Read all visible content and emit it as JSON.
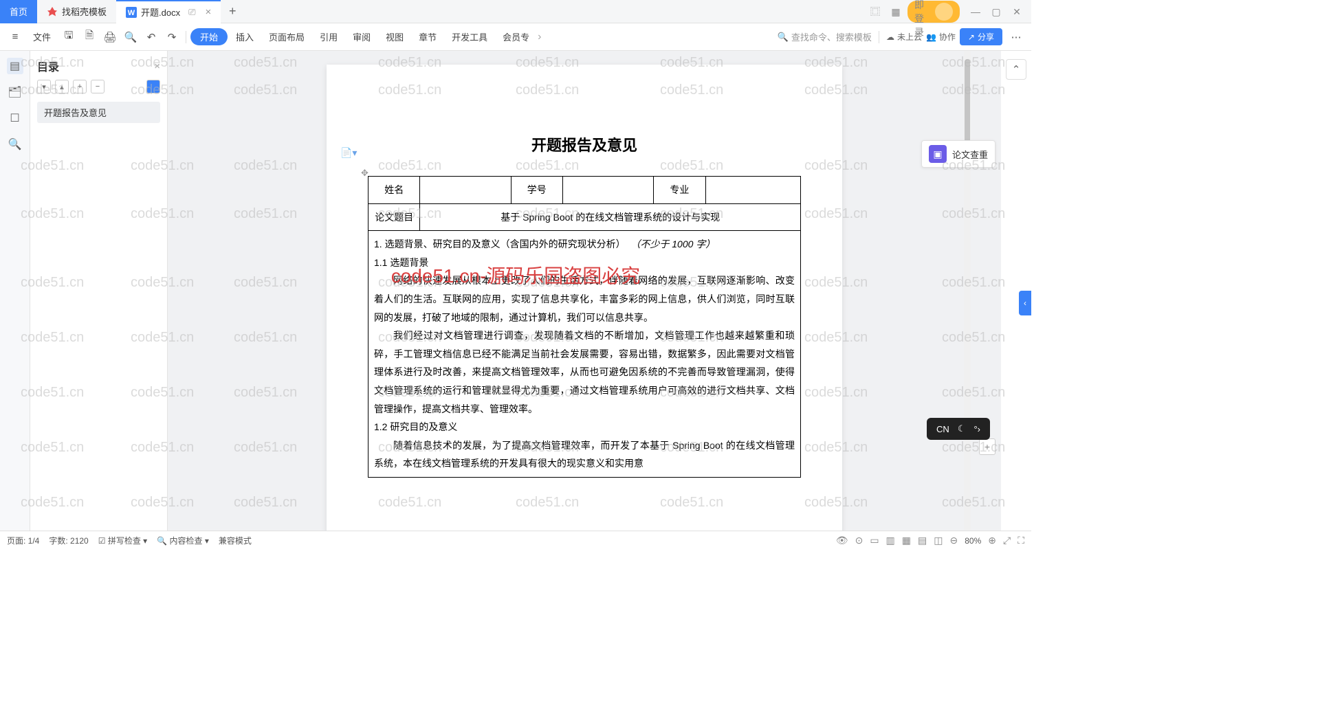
{
  "tabs": {
    "home": "首页",
    "t1": "找稻壳模板",
    "t2": "开题.docx"
  },
  "login": "立即登录",
  "file_label": "文件",
  "ribbon": [
    "开始",
    "插入",
    "页面布局",
    "引用",
    "审阅",
    "视图",
    "章节",
    "开发工具",
    "会员专"
  ],
  "search_placeholder": "查找命令、搜索模板",
  "cloud": "未上云",
  "collab": "协作",
  "share": "分享",
  "outline": {
    "title": "目录",
    "item": "开题报告及意见"
  },
  "rp_check": "论文查重",
  "doc": {
    "title": "开题报告及意见",
    "h_name": "姓名",
    "h_id": "学号",
    "h_major": "专业",
    "h_topic": "论文题目",
    "topic": "基于 Spring Boot 的在线文档管理系统的设计与实现",
    "s1": "1. 选题背景、研究目的及意义（含国内外的研究现状分析）",
    "s1_note": "（不少于 1000 字）",
    "s11": "1.1 选题背景",
    "p1": "网络的快速发展从根本上更改了人们的生活方式，伴随着网络的发展，互联网逐渐影响、改变着人们的生活。互联网的应用，实现了信息共享化，丰富多彩的网上信息，供人们浏览，同时互联网的发展，打破了地域的限制，通过计算机，我们可以信息共享。",
    "p2": "我们经过对文档管理进行调查，发现随着文档的不断增加，文档管理工作也越来越繁重和琐碎，手工管理文档信息已经不能满足当前社会发展需要，容易出错，数据繁多，因此需要对文档管理体系进行及时改善，来提高文档管理效率，从而也可避免因系统的不完善而导致管理漏洞，使得文档管理系统的运行和管理就显得尤为重要，通过文档管理系统用户可高效的进行文档共享、文档管理操作，提高文档共享、管理效率。",
    "s12": "1.2 研究目的及意义",
    "p3": "随着信息技术的发展，为了提高文档管理效率，而开发了本基于 Spring Boot 的在线文档管理系统，本在线文档管理系统的开发具有很大的现实意义和实用意"
  },
  "status": {
    "page": "页面: 1/4",
    "words": "字数: 2120",
    "spell": "拼写检查",
    "content": "内容检查",
    "compat": "兼容模式",
    "zoom": "80%"
  },
  "ime": "CN",
  "wm": "code51.cn",
  "wm_red": "code51.cn-源码乐园盗图必究"
}
